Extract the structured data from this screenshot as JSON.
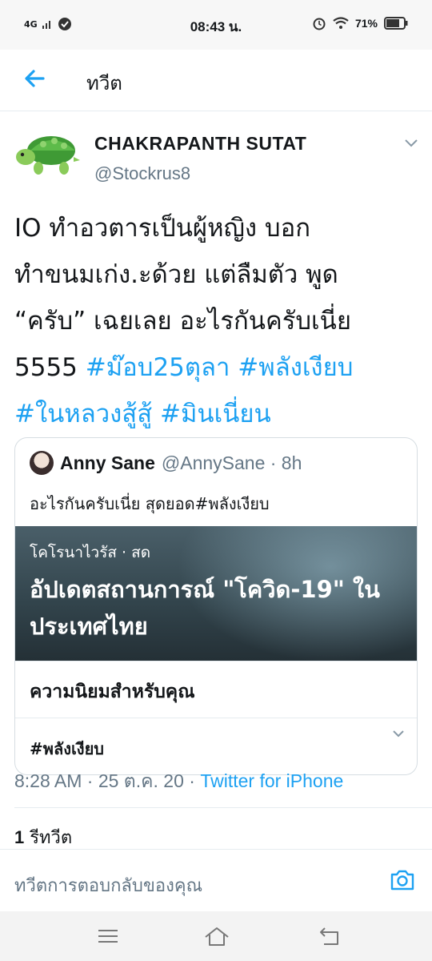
{
  "status_bar": {
    "network": "4G",
    "time": "08:43 น.",
    "battery": "71%"
  },
  "header": {
    "title": "ทวีต",
    "back_icon": "arrow-left-icon"
  },
  "author": {
    "name": "CHAKRAPANTH  SUTAT",
    "handle": "@Stockrus8",
    "avatar_icon": "turtle-avatar"
  },
  "tweet": {
    "line1": "IO ทำอวตารเป็นผู้หญิง บอก",
    "line2": "ทำขนมเก่ง.ะด้วย แต่ลืมตัว พูด",
    "line3": "“ครับ” เฉยเลย อะไรกันครับเนี่ย",
    "line4_prefix": "5555 ",
    "tags": [
      "#ม๊อบ25ตุลา",
      "#พลังเงียบ",
      "#ในหลวงสู้สู้",
      "#มินเนี่ยน"
    ]
  },
  "quote": {
    "name": "Anny Sane",
    "handle": "@AnnySane · 8h",
    "text": "อะไรกันครับเนี่ย สุดยอด#พลังเงียบ",
    "news_category": "โคโรนาไวรัส · สด",
    "news_title": "อัปเดตสถานการณ์ \"โควิด-19\" ในประเทศไทย",
    "for_you_title": "ความนิยมสำหรับคุณ",
    "trend": "#พลังเงียบ"
  },
  "meta": {
    "time_date": "8:28 AM · 25 ต.ค. 20 · ",
    "source": "Twitter for iPhone"
  },
  "retweets": {
    "count": "1",
    "label": " รีทวีต"
  },
  "reply": {
    "placeholder": "ทวีตการตอบกลับของคุณ"
  },
  "colors": {
    "accent": "#1da1f2",
    "secondary_text": "#657786"
  }
}
